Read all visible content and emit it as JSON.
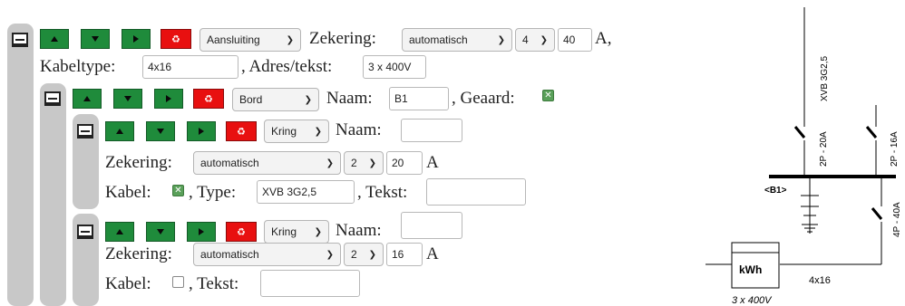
{
  "root": {
    "type_value": "Aansluiting",
    "fuse_label": "Zekering:",
    "fuse_type": "automatisch",
    "poles": "4",
    "amps": "40",
    "amps_unit": "A,",
    "cable_label": "Kabeltype:",
    "cable_value": "4x16",
    "address_label": ", Adres/tekst:",
    "address_value": "3 x 400V"
  },
  "board": {
    "type_value": "Bord",
    "name_label": "Naam:",
    "name_value": "B1",
    "grounded_label": ", Geaard:",
    "grounded_checked": true
  },
  "circuit1": {
    "type_value": "Kring",
    "name_label": "Naam:",
    "name_value": "",
    "fuse_label": "Zekering:",
    "fuse_type": "automatisch",
    "poles": "2",
    "amps": "20",
    "amps_unit": "A",
    "cable_label": "Kabel:",
    "cable_checked": true,
    "type_label": ", Type:",
    "type_input": "XVB 3G2,5",
    "text_label": ", Tekst:",
    "text_value": ""
  },
  "circuit2": {
    "type_value": "Kring",
    "name_label": "Naam:",
    "name_value": "",
    "fuse_label": "Zekering:",
    "fuse_type": "automatisch",
    "poles": "2",
    "amps": "16",
    "amps_unit": "A",
    "cable_label": "Kabel:",
    "cable_checked": false,
    "text_label": ", Tekst:",
    "text_value": ""
  },
  "diagram": {
    "cable1": "XVB 3G2,5",
    "switch1": "2P - 20A",
    "switch2": "2P - 16A",
    "board_label": "<B1>",
    "main_switch": "4P - 40A",
    "meter": "kWh",
    "cable_main": "4x16",
    "supply": "3 x 400V"
  },
  "icons": {
    "up": "arrow-up-icon",
    "down": "arrow-down-icon",
    "right": "arrow-right-icon",
    "delete": "recycle-icon"
  },
  "colors": {
    "move_button": "#1f8b3b",
    "delete_button": "#e81010",
    "tree_bar": "#c8c8c8"
  }
}
